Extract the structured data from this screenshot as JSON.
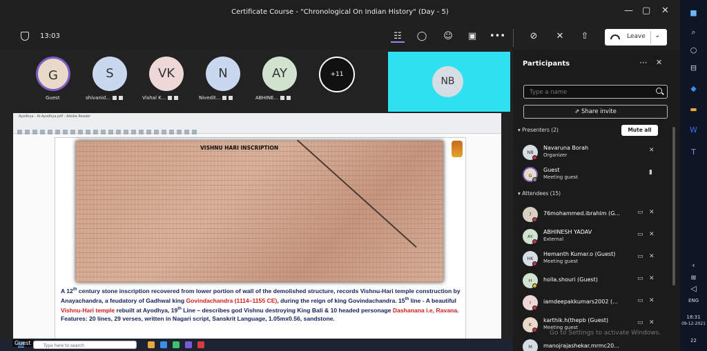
{
  "window": {
    "title": "Certificate Course - \"Chronological On Indian History\" (Day - 5)",
    "controls": [
      "—",
      "▢",
      "✕"
    ]
  },
  "toolbar": {
    "time": "13:03",
    "icons": [
      "people-icon",
      "chat-icon",
      "reactions-icon",
      "rooms-icon",
      "more-icon",
      "camera-off-icon",
      "mic-off-icon",
      "share-icon"
    ],
    "leave_label": "Leave"
  },
  "stage": {
    "avatars": [
      {
        "initials": "G",
        "caption": "Guest",
        "color": "#e8d9c8"
      },
      {
        "initials": "S",
        "caption": "shivanid...",
        "color": "#c9d7ef"
      },
      {
        "initials": "VK",
        "caption": "Vishal K...",
        "color": "#edd7d7"
      },
      {
        "initials": "N",
        "caption": "Nivedit...",
        "color": "#c9d7ef"
      },
      {
        "initials": "AY",
        "caption": "ABHINE...",
        "color": "#cfe3cf"
      }
    ],
    "overflow": "+11",
    "spotlight_initials": "NB",
    "spotlight_color": "#2ee0f0",
    "guest_label": "Guest"
  },
  "shared": {
    "reader_title": "Ayodhya - Al-Ayodhya.pdf - Adobe Reader",
    "inscription_title": "VISHNU HARI INSCRIPTION",
    "desc1a": "A 12",
    "desc1sup": "th",
    "desc1b": " century stone inscription recovered from lower portion of wall of the demolished structure, records Vishnu-Hari temple construction by Anayachandra, a feudatory of Gadhwal king ",
    "desc_red1": "Govindachandra (1114–1155 CE)",
    "desc2": ", during the reign of king Govindachandra. 15",
    "desc2sup": "th",
    "desc3": " line -  A beautiful ",
    "desc_red2": "Vishnu-Hari temple",
    "desc4": " rebuilt at Ayodhya, 19",
    "desc4sup": "th",
    "desc5": " Line – describes god Vishnu destroying King Bali & 10 headed personage ",
    "desc_red3": "Dashanana i.e, Ravana",
    "desc6": ". Features: 20 lines, 29 verses, written in Nagari script, Sanskrit Language, 1.05mx0.56, sandstone.",
    "taskbar_search": "Type here to search"
  },
  "panel": {
    "title": "Participants",
    "search_placeholder": "Type a name",
    "share_invite": "Share invite",
    "presenters_label": "Presenters (2)",
    "mute_all": "Mute all",
    "attendees_label": "Attendees (15)",
    "presenters": [
      {
        "initials": "NB",
        "name": "Navaruna Borah",
        "role": "Organizer",
        "color": "#d6dde3"
      },
      {
        "initials": "G",
        "name": "Guest",
        "role": "Meeting guest",
        "color": "#e8d9c8"
      }
    ],
    "attendees": [
      {
        "initials": "7",
        "name": "76mohammed.ibrahim (G...",
        "role": "",
        "color": "#d9d0c4"
      },
      {
        "initials": "AY",
        "name": "ABHINESH YADAV",
        "role": "External",
        "color": "#cfe3cf"
      },
      {
        "initials": "HK",
        "name": "Hemanth Kumar.o (Guest)",
        "role": "Meeting guest",
        "color": "#d6dde3"
      },
      {
        "initials": "H",
        "name": "holla.shouri (Guest)",
        "role": "",
        "color": "#cfe3cf"
      },
      {
        "initials": "I",
        "name": "iamdeepakkumars2002 (...",
        "role": "",
        "color": "#edd7d7"
      },
      {
        "initials": "K",
        "name": "karthik.h(thepb (Guest)",
        "role": "Meeting guest",
        "color": "#e8d9c8"
      },
      {
        "initials": "M",
        "name": "manojrajashekar.mrmc20...",
        "role": "",
        "color": "#d6dde3"
      }
    ],
    "watermark": "Go to Settings to activate Windows."
  },
  "desktop": {
    "lang": "ENG",
    "time": "18:31",
    "date": "09-12-2021",
    "notif_count": "22"
  }
}
